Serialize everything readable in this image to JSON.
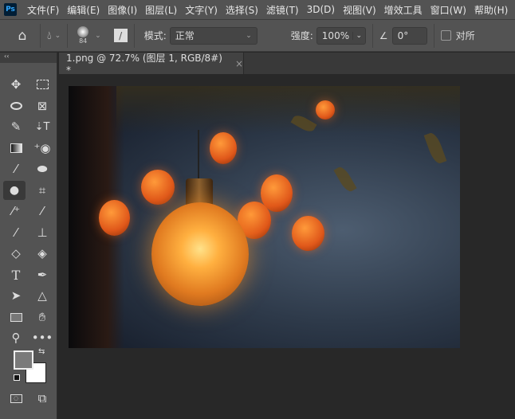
{
  "app": {
    "logo": "Ps"
  },
  "menu": [
    "文件(F)",
    "编辑(E)",
    "图像(I)",
    "图层(L)",
    "文字(Y)",
    "选择(S)",
    "滤镜(T)",
    "3D(D)",
    "视图(V)",
    "增效工具",
    "窗口(W)",
    "帮助(H)"
  ],
  "options": {
    "brush_size": "84",
    "mode_label": "模式:",
    "mode_value": "正常",
    "strength_label": "强度:",
    "strength_value": "100%",
    "angle_value": "0°",
    "sample_all_label": "对所"
  },
  "document": {
    "tab_title": "1.png @ 72.7% (图层 1, RGB/8#) *",
    "close": "×"
  },
  "toolbar": {
    "collapse": "‹‹"
  },
  "colors": {
    "foreground": "#7a7a7a",
    "background": "#ffffff"
  }
}
